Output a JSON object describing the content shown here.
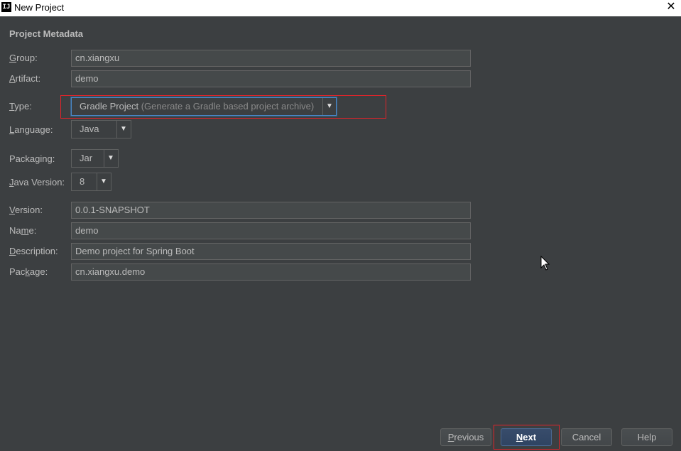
{
  "window": {
    "app_icon_text": "IJ",
    "title": "New Project",
    "close_glyph": "✕"
  },
  "section": {
    "title": "Project Metadata"
  },
  "fields": {
    "group": {
      "mnemonic": "G",
      "label_rest": "roup:",
      "value": "cn.xiangxu"
    },
    "artifact": {
      "mnemonic": "A",
      "label_rest": "rtifact:",
      "value": "demo"
    },
    "version": {
      "mnemonic": "V",
      "label_rest": "ersion:",
      "value": "0.0.1-SNAPSHOT"
    },
    "name": {
      "label_pre": "Na",
      "mnemonic": "m",
      "label_rest": "e:",
      "value": "demo"
    },
    "description": {
      "mnemonic": "D",
      "label_rest": "escription:",
      "value": "Demo project for Spring Boot"
    },
    "package": {
      "label_pre": "Pac",
      "mnemonic": "k",
      "label_rest": "age:",
      "value": "cn.xiangxu.demo"
    }
  },
  "combos": {
    "type": {
      "mnemonic": "T",
      "label_rest": "ype:",
      "value": "Gradle Project",
      "hint": "(Generate a Gradle based project archive)"
    },
    "language": {
      "label_pre": "",
      "mnemonic": "L",
      "label_rest": "anguage:",
      "value": "Java"
    },
    "packaging": {
      "label_pre": "Packa",
      "mnemonic": "g",
      "label_rest": "ing:",
      "value": "Jar"
    },
    "java_version": {
      "mnemonic": "J",
      "label_rest": "ava Version:",
      "value": "8"
    }
  },
  "buttons": {
    "previous": {
      "mnemonic": "P",
      "rest": "revious"
    },
    "next": {
      "mnemonic": "N",
      "rest": "ext"
    },
    "cancel": {
      "label": "Cancel"
    },
    "help": {
      "label": "Help"
    }
  },
  "icons": {
    "dropdown": "▼"
  },
  "colors": {
    "background": "#3c3f41",
    "highlight_box": "#e0242a",
    "focus_border": "#4a88c7",
    "default_button": "#2f4462"
  }
}
